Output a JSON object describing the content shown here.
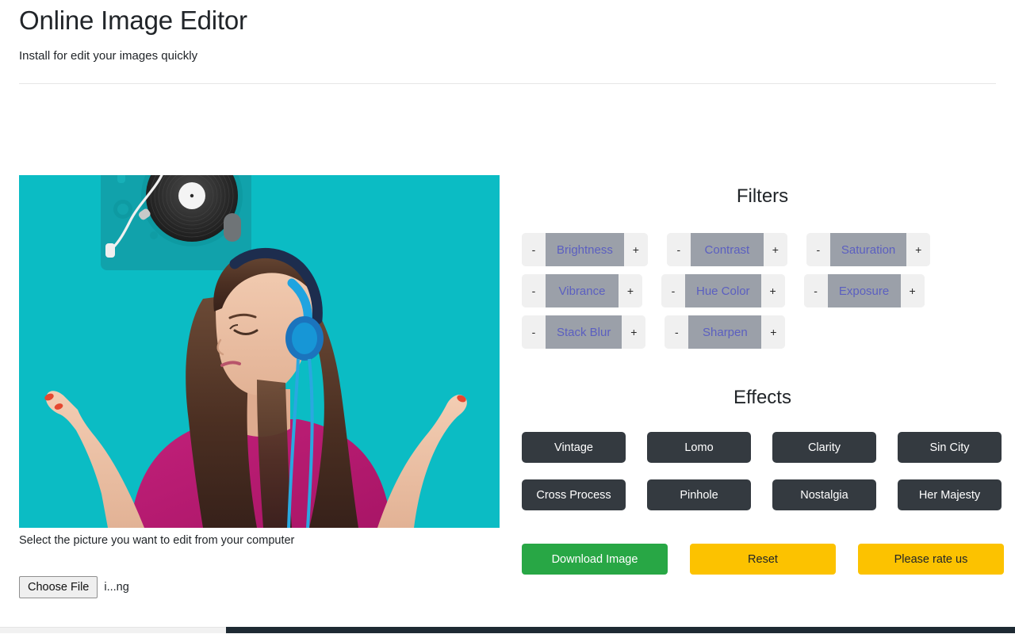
{
  "header": {
    "title": "Online Image Editor",
    "subtitle": "Install for edit your images quickly"
  },
  "editor": {
    "select_hint": "Select the picture you want to edit from your computer",
    "choose_file_label": "Choose File",
    "file_name": "i...ng",
    "image_background_color": "#0bbcc4",
    "image_description": "Woman with headphones and turntable on teal background"
  },
  "filters": {
    "title": "Filters",
    "decrement_label": "-",
    "increment_label": "+",
    "items": [
      {
        "label": "Brightness"
      },
      {
        "label": "Contrast"
      },
      {
        "label": "Saturation"
      },
      {
        "label": "Vibrance"
      },
      {
        "label": "Hue Color"
      },
      {
        "label": "Exposure"
      },
      {
        "label": "Stack Blur"
      },
      {
        "label": "Sharpen"
      }
    ]
  },
  "effects": {
    "title": "Effects",
    "items": [
      {
        "label": "Vintage"
      },
      {
        "label": "Lomo"
      },
      {
        "label": "Clarity"
      },
      {
        "label": "Sin City"
      },
      {
        "label": "Cross Process"
      },
      {
        "label": "Pinhole"
      },
      {
        "label": "Nostalgia"
      },
      {
        "label": "Her Majesty"
      }
    ]
  },
  "actions": {
    "download_label": "Download Image",
    "reset_label": "Reset",
    "rate_label": "Please rate us",
    "download_color": "#28a745",
    "reset_color": "#fcc200",
    "rate_color": "#fcc200"
  }
}
